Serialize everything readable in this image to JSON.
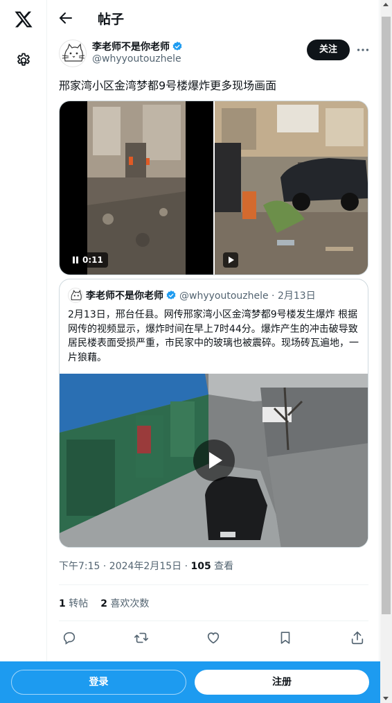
{
  "header": {
    "title": "帖子"
  },
  "post": {
    "author_name": "李老师不是你老师",
    "author_handle": "@whyyoutouzhele",
    "follow_label": "关注",
    "text": "邢家湾小区金湾梦都9号楼爆炸更多现场画面",
    "video_timer": "0:11",
    "timestamp": "下午7:15 · 2024年2月15日 · ",
    "views_count": "105",
    "views_label": " 查看",
    "reposts_count": "1",
    "reposts_label": " 转帖",
    "likes_count": "2",
    "likes_label": " 喜欢次数"
  },
  "quoted": {
    "author_name": "李老师不是你老师",
    "author_handle": "@whyyoutouzhele",
    "dot": " · ",
    "date": "2月13日",
    "text": "2月13日，邢台任县。网传邢家湾小区金湾梦都9号楼发生爆炸 根据网传的视频显示，爆炸时间在早上7时44分。爆炸产生的冲击破导致居民楼表面受损严重，市民家中的玻璃也被震碎。现场砖瓦遍地，一片狼藉。"
  },
  "bottom_bar": {
    "login_label": "登录",
    "signup_label": "注册"
  },
  "colors": {
    "accent": "#1d9bf0",
    "text_primary": "#0f1419",
    "text_secondary": "#536471",
    "border": "#cfd9de",
    "verified": "#1d9bf0"
  },
  "icons": {
    "logo": "x-logo-icon",
    "settings": "gear-icon",
    "back": "arrow-left-icon",
    "verified": "verified-badge-icon",
    "more": "more-dots-icon",
    "reply": "reply-icon",
    "repost": "repost-icon",
    "like": "heart-icon",
    "bookmark": "bookmark-icon",
    "share": "share-icon"
  }
}
